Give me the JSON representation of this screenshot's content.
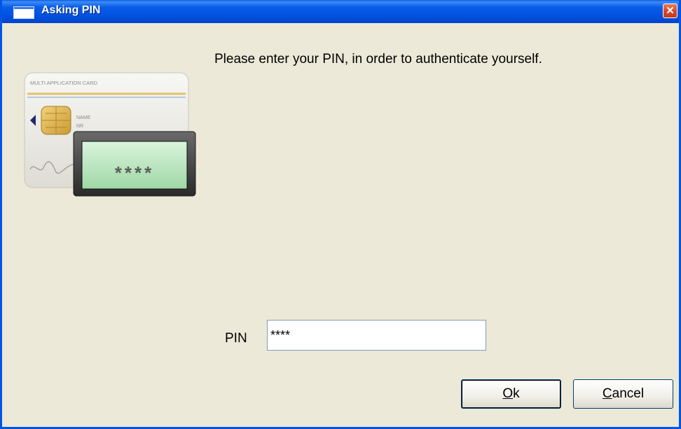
{
  "window": {
    "title": "Asking PIN",
    "close_glyph": "✕"
  },
  "message": "Please enter your PIN, in order to authenticate yourself.",
  "illustration": {
    "card_header": "MULTI APPLICATION CARD",
    "card_name": "NAME",
    "card_nr": "NR",
    "screen_text": "****"
  },
  "pin": {
    "label": "PIN",
    "value": "****"
  },
  "buttons": {
    "ok": {
      "mnemonic": "O",
      "rest": "k"
    },
    "cancel": {
      "mnemonic": "C",
      "rest": "ancel"
    }
  },
  "colors": {
    "titlebar": "#0a5ee8",
    "dialog_bg": "#ece9d8",
    "close": "#d9482a"
  },
  "icons": [
    "window-icon",
    "close-icon",
    "smart-card-icon",
    "pin-reader-icon",
    "signature-icon"
  ]
}
